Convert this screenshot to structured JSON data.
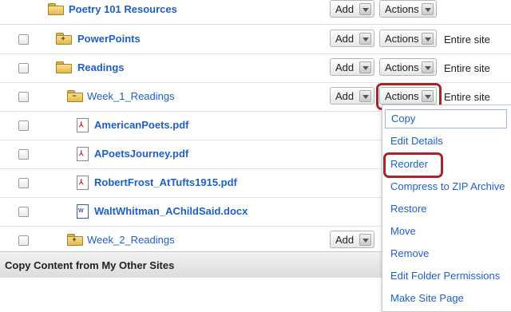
{
  "rows": [
    {
      "label": "Poetry 101 Resources",
      "type": "folder-root",
      "add": "Add",
      "actions": "Actions",
      "scope": ""
    },
    {
      "label": "PowerPoints",
      "type": "folder-plus",
      "add": "Add",
      "actions": "Actions",
      "scope": "Entire site"
    },
    {
      "label": "Readings",
      "type": "folder-open",
      "add": "Add",
      "actions": "Actions",
      "scope": "Entire site"
    },
    {
      "label": "Week_1_Readings",
      "type": "folder-minus",
      "add": "Add",
      "actions": "Actions",
      "scope": "Entire site"
    },
    {
      "label": "AmericanPoets.pdf",
      "type": "pdf"
    },
    {
      "label": "APoetsJourney.pdf",
      "type": "pdf"
    },
    {
      "label": "RobertFrost_AtTufts1915.pdf",
      "type": "pdf"
    },
    {
      "label": "WaltWhitman_AChildSaid.docx",
      "type": "doc"
    },
    {
      "label": "Week_2_Readings",
      "type": "folder-plus",
      "add": "Add"
    }
  ],
  "actions_menu": {
    "items": [
      "Copy",
      "Edit Details",
      "Reorder",
      "Compress to ZIP Archive",
      "Restore",
      "Move",
      "Remove",
      "Edit Folder Permissions",
      "Make Site Page"
    ]
  },
  "footer": {
    "label": "Copy Content from My Other Sites"
  },
  "colors": {
    "link": "#1e5fc6",
    "highlight": "#a8232a"
  }
}
